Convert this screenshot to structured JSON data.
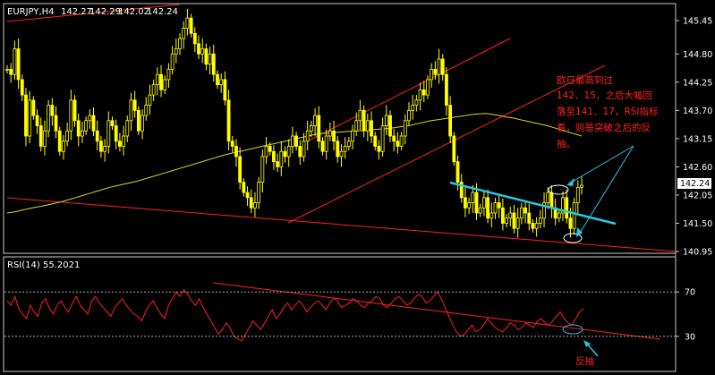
{
  "header": {
    "symbol": "EURJPY,H4",
    "open": "142.27",
    "high": "142.29",
    "low": "142.02",
    "close": "142.24"
  },
  "rsi_header": "RSI(14) 55.2021",
  "current_price_label": "142.24",
  "annotation": {
    "lines": [
      "欧日最高到过",
      "142．15，之后大幅回",
      "落至141．17，RSI指标",
      "看，则是突破之后的反",
      "抽。"
    ]
  },
  "rsi_annotation": "反抽",
  "colors": {
    "background": "#000000",
    "candle": "#ffff00",
    "ma": "#d8d820",
    "trendline": "#ff2020",
    "support_line": "#29c6e8",
    "arrow": "#29c6e8",
    "rsi_line": "#ff2020",
    "annotation_text": "#ff2020"
  },
  "chart_data": [
    {
      "type": "candlestick",
      "title": "EURJPY,H4",
      "y_ticks": [
        "145.45",
        "144.80",
        "144.25",
        "143.70",
        "143.15",
        "142.60",
        "142.05",
        "141.50",
        "140.95"
      ],
      "ylim": [
        140.95,
        145.45
      ],
      "last_price": 142.24,
      "close_series": [
        144.5,
        144.4,
        144.9,
        144.3,
        144.0,
        143.2,
        143.9,
        143.6,
        143.4,
        143.0,
        143.3,
        143.8,
        143.6,
        143.3,
        142.9,
        143.1,
        143.3,
        143.9,
        143.5,
        143.2,
        143.3,
        143.5,
        143.6,
        143.3,
        143.1,
        142.9,
        143.0,
        143.5,
        143.4,
        143.1,
        143.0,
        143.2,
        143.5,
        143.9,
        143.7,
        143.3,
        143.6,
        143.8,
        144.0,
        144.2,
        144.4,
        144.1,
        144.3,
        144.5,
        144.8,
        144.9,
        145.1,
        145.3,
        145.5,
        145.2,
        145.0,
        144.8,
        144.9,
        144.6,
        144.8,
        144.4,
        144.2,
        144.3,
        143.9,
        143.1,
        143.0,
        142.8,
        142.3,
        142.1,
        142.0,
        141.8,
        141.9,
        142.3,
        142.8,
        143.0,
        142.9,
        142.7,
        142.6,
        142.9,
        142.8,
        143.0,
        143.2,
        143.0,
        142.8,
        143.1,
        143.3,
        143.4,
        143.6,
        143.1,
        142.9,
        143.2,
        143.3,
        143.1,
        142.8,
        142.9,
        143.0,
        143.1,
        143.3,
        143.5,
        143.7,
        143.3,
        143.5,
        143.2,
        143.0,
        142.9,
        143.4,
        143.6,
        143.2,
        143.1,
        143.0,
        143.2,
        143.5,
        143.7,
        143.8,
        143.9,
        144.1,
        144.0,
        144.3,
        144.5,
        144.4,
        144.7,
        144.4,
        143.8,
        143.2,
        142.7,
        142.3,
        142.0,
        141.8,
        141.9,
        142.1,
        141.7,
        141.8,
        142.0,
        141.6,
        141.7,
        141.9,
        141.8,
        141.5,
        141.6,
        141.7,
        141.4,
        141.6,
        141.8,
        141.7,
        141.5,
        141.4,
        141.5,
        141.6,
        141.9,
        142.1,
        141.8,
        141.6,
        141.7,
        142.0,
        141.6,
        141.4,
        141.9,
        142.2,
        142.24
      ],
      "ma_series": [
        141.7,
        141.72,
        141.75,
        141.78,
        141.81,
        141.83,
        141.86,
        141.89,
        141.92,
        141.96,
        142.0,
        142.04,
        142.08,
        142.12,
        142.16,
        142.2,
        142.23,
        142.26,
        142.29,
        142.32,
        142.36,
        142.4,
        142.44,
        142.48,
        142.52,
        142.56,
        142.6,
        142.64,
        142.68,
        142.72,
        142.76,
        142.8,
        142.84,
        142.87,
        142.9,
        142.93,
        142.96,
        142.99,
        143.02,
        143.05,
        143.08,
        143.11,
        143.14,
        143.17,
        143.2,
        143.23,
        143.25,
        143.26,
        143.27,
        143.28,
        143.29,
        143.3,
        143.31,
        143.32,
        143.33,
        143.34,
        143.35,
        143.37,
        143.39,
        143.41,
        143.44,
        143.47,
        143.5,
        143.52,
        143.54,
        143.56,
        143.58,
        143.6,
        143.62,
        143.63,
        143.64,
        143.62,
        143.6,
        143.57,
        143.55,
        143.52,
        143.49,
        143.46,
        143.43,
        143.4,
        143.36,
        143.32,
        143.28,
        143.24,
        143.2
      ]
    },
    {
      "type": "line",
      "title": "RSI(14) 55.2021",
      "y_ticks": [
        "70",
        "30"
      ],
      "ylim": [
        0,
        100
      ],
      "last_value": 55.2021,
      "rsi_series": [
        62,
        58,
        66,
        55,
        50,
        46,
        58,
        52,
        48,
        60,
        64,
        55,
        50,
        58,
        62,
        56,
        52,
        60,
        66,
        58,
        54,
        50,
        62,
        66,
        60,
        56,
        52,
        48,
        56,
        60,
        64,
        58,
        54,
        50,
        48,
        44,
        52,
        58,
        62,
        56,
        50,
        46,
        58,
        64,
        70,
        66,
        72,
        68,
        62,
        58,
        64,
        56,
        50,
        44,
        38,
        32,
        36,
        42,
        38,
        30,
        28,
        26,
        32,
        38,
        44,
        40,
        36,
        42,
        48,
        54,
        46,
        50,
        56,
        60,
        54,
        58,
        62,
        58,
        52,
        56,
        60,
        62,
        58,
        54,
        60,
        64,
        62,
        56,
        58,
        60,
        64,
        62,
        58,
        56,
        60,
        62,
        66,
        64,
        58,
        56,
        60,
        64,
        66,
        62,
        58,
        60,
        64,
        68,
        66,
        60,
        62,
        66,
        70,
        64,
        56,
        48,
        40,
        34,
        30,
        32,
        36,
        40,
        34,
        36,
        40,
        46,
        42,
        38,
        36,
        34,
        38,
        42,
        40,
        36,
        38,
        42,
        40,
        38,
        44,
        46,
        42,
        40,
        44,
        48,
        52,
        46,
        42,
        40,
        46,
        52,
        55
      ]
    }
  ]
}
